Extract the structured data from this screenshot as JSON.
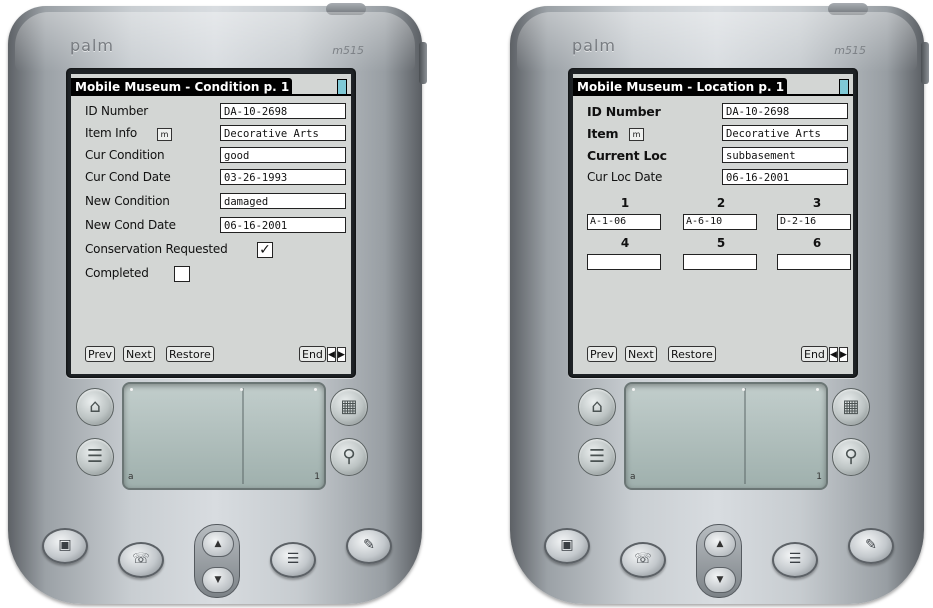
{
  "devices": [
    {
      "brand": "palm",
      "model": "m515",
      "screen": {
        "title": "Mobile Museum - Condition p. 1",
        "fields": [
          {
            "label": "ID Number",
            "value": "DA-10-2698"
          },
          {
            "label": "Item Info",
            "value": "Decorative Arts"
          },
          {
            "label": "Cur Condition",
            "value": "good"
          },
          {
            "label": "Cur Cond Date",
            "value": "03-26-1993"
          },
          {
            "label": "New Condition",
            "value": "damaged"
          },
          {
            "label": "New Cond Date",
            "value": "06-16-2001"
          }
        ],
        "note_icon": "m",
        "checkboxes": [
          {
            "label": "Conservation Requested",
            "checked": true,
            "mark": "✓"
          },
          {
            "label": "Completed",
            "checked": false,
            "mark": ""
          }
        ],
        "buttons": {
          "prev": "Prev",
          "next": "Next",
          "restore": "Restore",
          "end": "End"
        }
      }
    },
    {
      "brand": "palm",
      "model": "m515",
      "screen": {
        "title": "Mobile Museum - Location p. 1",
        "fields": [
          {
            "label": "ID Number",
            "value": "DA-10-2698"
          },
          {
            "label": "Item",
            "value": "Decorative Arts"
          },
          {
            "label": "Current Loc",
            "value": "subbasement"
          },
          {
            "label": "Cur Loc Date",
            "value": "06-16-2001"
          }
        ],
        "note_icon": "m",
        "locations": [
          {
            "num": "1",
            "value": "A-1-06"
          },
          {
            "num": "2",
            "value": "A-6-10"
          },
          {
            "num": "3",
            "value": "D-2-16"
          },
          {
            "num": "4",
            "value": ""
          },
          {
            "num": "5",
            "value": ""
          },
          {
            "num": "6",
            "value": ""
          }
        ],
        "buttons": {
          "prev": "Prev",
          "next": "Next",
          "restore": "Restore",
          "end": "End"
        }
      }
    }
  ],
  "icons": {
    "home": "home-icon",
    "menu": "menu-icon",
    "calc": "calculator-icon",
    "find": "find-icon",
    "arrow_left": "◀",
    "arrow_right": "▶",
    "graffiti_abc": "a",
    "graffiti_123": "1"
  },
  "hardware_buttons": [
    "date-book",
    "address",
    "todo",
    "memo"
  ]
}
